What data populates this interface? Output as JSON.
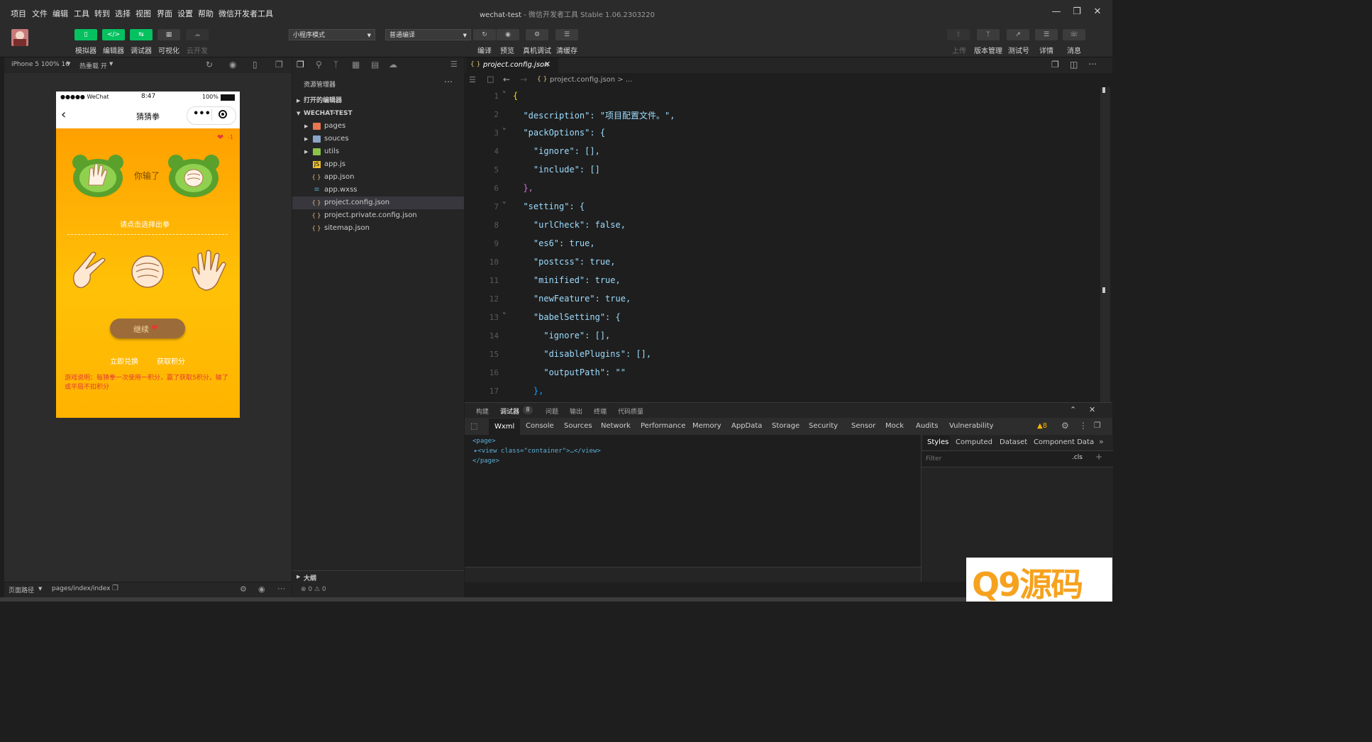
{
  "menu": [
    "项目",
    "文件",
    "编辑",
    "工具",
    "转到",
    "选择",
    "视图",
    "界面",
    "设置",
    "帮助",
    "微信开发者工具"
  ],
  "window": {
    "title": "wechat-test",
    "subtitle": "- 微信开发者工具 Stable 1.06.2303220"
  },
  "toolbar": {
    "left_buttons": [
      "模拟器",
      "编辑器",
      "调试器",
      "可视化",
      "云开发"
    ],
    "mode_select": "小程序模式",
    "compile_select": "普通编译",
    "center_buttons": [
      "编译",
      "预览",
      "真机调试",
      "清缓存"
    ],
    "right_buttons": [
      "上传",
      "版本管理",
      "测试号",
      "详情",
      "消息"
    ]
  },
  "simulator": {
    "device": "iPhone 5 100% 16",
    "hot_reload": "热重载 开",
    "footer_path_label": "页面路径",
    "footer_path": "pages/index/index"
  },
  "phone": {
    "carrier": "●●●●● WeChat",
    "time": "8:47",
    "battery": "100%",
    "nav_title": "猜猜拳",
    "lives": "-1",
    "result_text": "你输了",
    "prompt": "请点击选择出拳",
    "continue_button": "继续",
    "link_exchange": "立即兑换",
    "link_points": "获取积分",
    "rules": "游戏说明：每猜拳一次使用一积分，赢了获取5积分，输了或平局不扣积分"
  },
  "explorer": {
    "title": "资源管理器",
    "open_editors": "打开的编辑器",
    "project": "WECHAT-TEST",
    "tree": [
      {
        "name": "pages",
        "type": "folder",
        "color": "#e8764f"
      },
      {
        "name": "souces",
        "type": "folder",
        "color": "#8aa4c8"
      },
      {
        "name": "utils",
        "type": "folder",
        "color": "#8bc34a"
      },
      {
        "name": "app.js",
        "type": "js",
        "color": "#f1c232"
      },
      {
        "name": "app.json",
        "type": "json",
        "color": "#e5c07b"
      },
      {
        "name": "app.wxss",
        "type": "wxss",
        "color": "#519aba"
      },
      {
        "name": "project.config.json",
        "type": "json",
        "color": "#e5c07b",
        "selected": true
      },
      {
        "name": "project.private.config.json",
        "type": "json",
        "color": "#e5c07b"
      },
      {
        "name": "sitemap.json",
        "type": "json",
        "color": "#e5c07b"
      }
    ],
    "outline": "大纲",
    "problems": "⊗ 0 ⚠ 0"
  },
  "editor": {
    "tab": "project.config.json",
    "breadcrumb": "project.config.json > ...",
    "line_numbers": [
      "1",
      "2",
      "3",
      "4",
      "5",
      "6",
      "7",
      "8",
      "9",
      "10",
      "11",
      "12",
      "13",
      "14",
      "15",
      "16",
      "17"
    ],
    "lines": [
      "{",
      "  \"description\": \"项目配置文件。\",",
      "  \"packOptions\": {",
      "    \"ignore\": [],",
      "    \"include\": []",
      "  },",
      "  \"setting\": {",
      "    \"urlCheck\": false,",
      "    \"es6\": true,",
      "    \"postcss\": true,",
      "    \"minified\": true,",
      "    \"newFeature\": true,",
      "    \"babelSetting\": {",
      "      \"ignore\": [],",
      "      \"disablePlugins\": [],",
      "      \"outputPath\": \"\"",
      "    },"
    ]
  },
  "devtools": {
    "top_tabs": [
      "构建",
      "调试器",
      "问题",
      "输出",
      "终端",
      "代码质量"
    ],
    "debugger_badge": "8",
    "tabs": [
      "Wxml",
      "Console",
      "Sources",
      "Network",
      "Performance",
      "Memory",
      "AppData",
      "Storage",
      "Security",
      "Sensor",
      "Mock",
      "Audits",
      "Vulnerability"
    ],
    "warn_count": "▲8",
    "wxml_lines": [
      "<page>",
      "▸<view class=\"container\">…</view>",
      "</page>"
    ],
    "style_tabs": [
      "Styles",
      "Computed",
      "Dataset",
      "Component Data"
    ],
    "filter_placeholder": "Filter",
    "cls": ".cls"
  },
  "watermark": "Q9源码"
}
